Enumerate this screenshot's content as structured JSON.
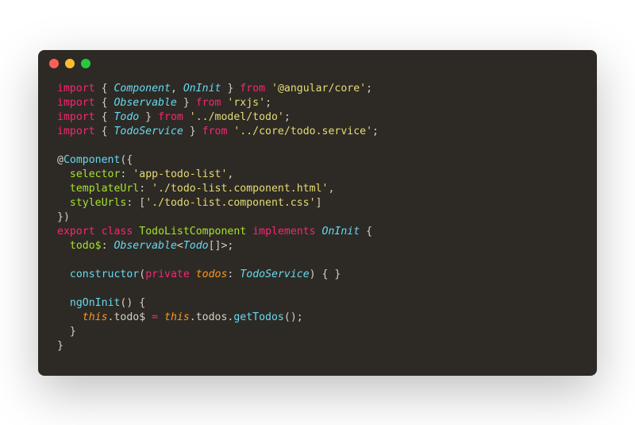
{
  "window": {
    "dots": [
      "red",
      "yellow",
      "green"
    ]
  },
  "code": {
    "l1": {
      "kw1": "import",
      "imp1": "Component",
      "c1": ", ",
      "imp2": "OnInit",
      "kw2": "from",
      "str": "'@angular/core'"
    },
    "l2": {
      "kw1": "import",
      "imp1": "Observable",
      "kw2": "from",
      "str": "'rxjs'"
    },
    "l3": {
      "kw1": "import",
      "imp1": "Todo",
      "kw2": "from",
      "str": "'../model/todo'"
    },
    "l4": {
      "kw1": "import",
      "imp1": "TodoService",
      "kw2": "from",
      "str": "'../core/todo.service'"
    },
    "dec": {
      "at": "@",
      "name": "Component"
    },
    "sel": {
      "key": "selector",
      "val": "'app-todo-list'"
    },
    "tpl": {
      "key": "templateUrl",
      "val": "'./todo-list.component.html'"
    },
    "sty": {
      "key": "styleUrls",
      "val": "'./todo-list.component.css'"
    },
    "cls": {
      "exp": "export",
      "cls": "class",
      "name": "TodoListComponent",
      "impl": "implements",
      "iface": "OnInit"
    },
    "field": {
      "name": "todo$",
      "type1": "Observable",
      "lt": "<",
      "type2": "Todo",
      "arr": "[]>;"
    },
    "ctor": {
      "name": "constructor",
      "priv": "private",
      "param": "todos",
      "ptype": "TodoService"
    },
    "init": {
      "name": "ngOnInit"
    },
    "assign": {
      "this1": "this",
      "prop1": ".todo$ ",
      "op": "=",
      "sp": " ",
      "this2": "this",
      "mid": ".todos.",
      "fn": "getTodos",
      "end": "();"
    }
  }
}
